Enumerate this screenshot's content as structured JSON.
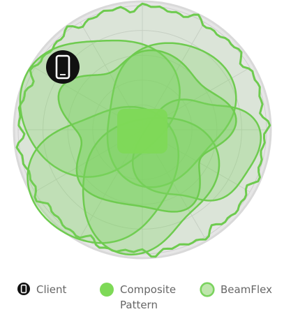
{
  "legend": {
    "client": {
      "label": "Client",
      "icon": "smartphone-icon"
    },
    "composite": {
      "label": "Composite\nPattern",
      "icon": "filled-circle-icon"
    },
    "beamflex": {
      "label": "BeamFlex",
      "icon": "outlined-circle-icon"
    }
  },
  "colors": {
    "background": "#ffffff",
    "polar_disc": "#e6e6e6",
    "polar_rim": "#d9d9d9",
    "grid": "#cfcfcf",
    "pattern_fill": "#7bd35f",
    "pattern_stroke": "#6ecb4f",
    "composite_fill": "#7ed957",
    "client_icon": "#111111",
    "legend_text": "#666666"
  }
}
